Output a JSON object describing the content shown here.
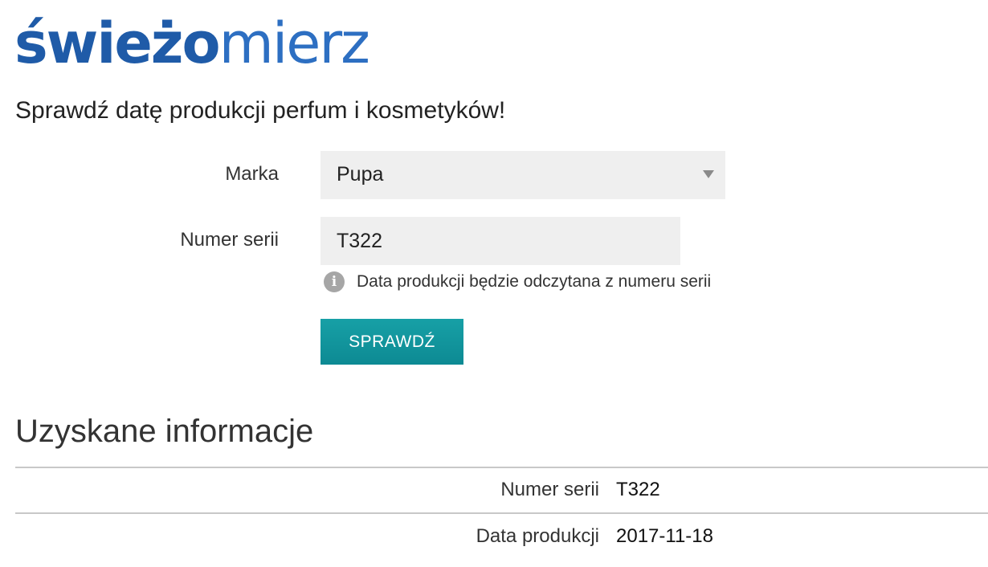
{
  "logo": {
    "part_bold": "świeżo",
    "part_light": "mierz",
    "color_bold": "#1f5ba8",
    "color_light": "#2d6fc2"
  },
  "subtitle": "Sprawdź datę produkcji perfum i kosmetyków!",
  "form": {
    "brand_label": "Marka",
    "brand_value": "Pupa",
    "serial_label": "Numer serii",
    "serial_value": "T322",
    "hint_icon": "info-icon",
    "hint_text": "Data produkcji będzie odczytana z numeru serii",
    "submit_label": "SPRAWDŹ",
    "accent_color": "#1499a0"
  },
  "results": {
    "title": "Uzyskane informacje",
    "rows": [
      {
        "label": "Numer serii",
        "value": "T322"
      },
      {
        "label": "Data produkcji",
        "value": "2017-11-18"
      }
    ]
  }
}
